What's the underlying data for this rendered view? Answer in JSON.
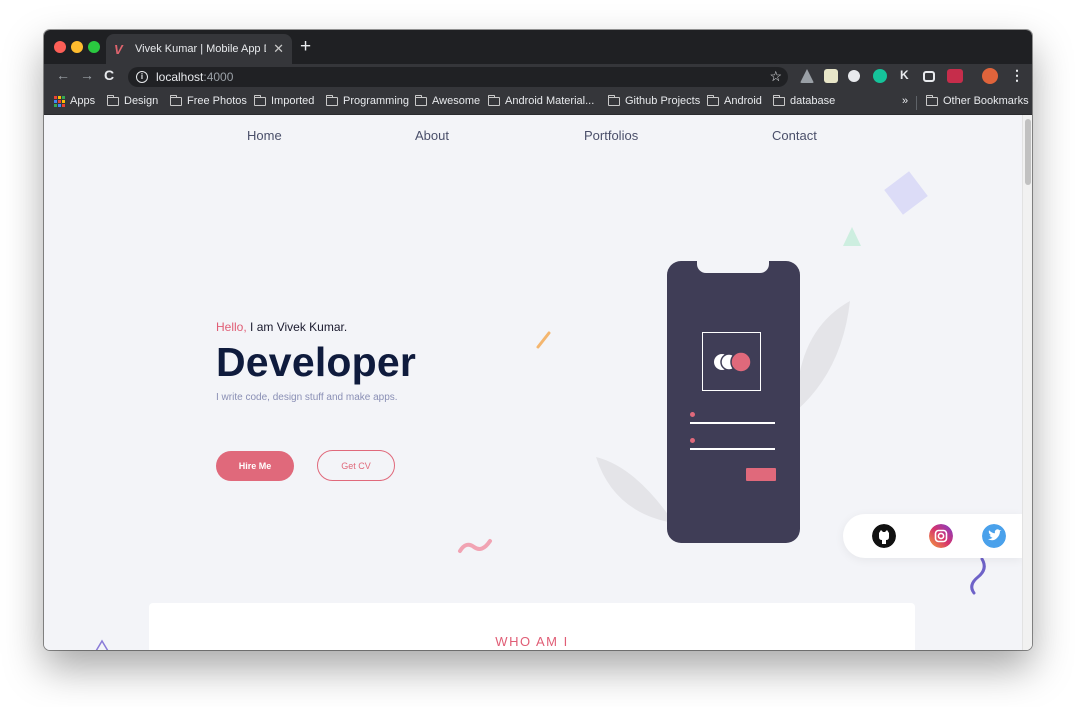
{
  "browser": {
    "tab_title": "Vivek Kumar | Mobile App Deve",
    "tab_favicon": "V",
    "url_host": "localhost",
    "url_port": ":4000"
  },
  "bookmarks": [
    "Apps",
    "Design",
    "Free Photos",
    "Imported",
    "Programming",
    "Awesome",
    "Android Material...",
    "Github Projects",
    "Android",
    "database"
  ],
  "bookmarks_overflow": "»",
  "other_bookmarks": "Other Bookmarks",
  "site_nav": [
    "Home",
    "About",
    "Portfolios",
    "Contact"
  ],
  "hero": {
    "greeting": "Hello,",
    "intro": " I am Vivek Kumar.",
    "title": "Developer",
    "subtitle": "I write code, design stuff and make apps.",
    "hire_button": "Hire Me",
    "cv_button": "Get CV"
  },
  "social": [
    "github-icon",
    "instagram-icon",
    "twitter-icon"
  ],
  "about": {
    "heading": "WHO AM I"
  },
  "colors": {
    "accent": "#e0697b",
    "title": "#0f1b3d",
    "phone": "#3f3d56",
    "background": "#f3f4f8"
  }
}
